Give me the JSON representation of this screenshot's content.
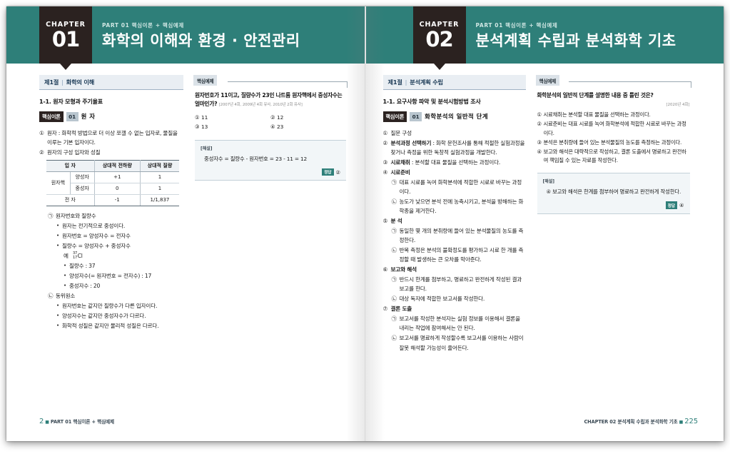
{
  "left_page": {
    "chapter": {
      "word": "CHAPTER",
      "number": "01",
      "kicker": "PART 01 핵심이론 + 핵심예제",
      "title": "화학의 이해와 환경 · 안전관리"
    },
    "section_bar": {
      "no": "제1절",
      "sep": "|",
      "title": "화학의 이해"
    },
    "topic": "1-1. 원자 모형과 주기율표",
    "core": {
      "tag": "핵심이론",
      "num": "01",
      "title": "원 자"
    },
    "items": {
      "i1_mark": "①",
      "i1_text": "원자 : 화학적 방법으로 더 이상 쪼갤 수 없는 입자로, 물질을 이루는 기본 입자이다.",
      "i2_mark": "②",
      "i2_text": "원자의 구성 입자와 성질",
      "i3_mark": "㉠",
      "i3_text": "원자번호와 질량수",
      "b1": "원자는 전기적으로 중성이다.",
      "b2": "원자번호 = 양성자수 = 전자수",
      "b3": "질량수 = 양성자수 + 중성자수",
      "ex_mark": "예",
      "ex_sup": "37",
      "ex_sub": "17",
      "ex_sym": "Cl",
      "b4": "질량수 : 37",
      "b5": "양성자수(= 원자번호 = 전자수) : 17",
      "b6": "중성자수 : 20",
      "i4_mark": "㉡",
      "i4_text": "동위원소",
      "b7": "원자번호는 같지만 질량수가 다른 입자이다.",
      "b8": "양성자수는 같지만 중성자수가 다르다.",
      "b9": "화학적 성질은 같지만 물리적 성질은 다르다.",
      "dot": "•"
    },
    "table": {
      "headers": [
        "입 자",
        "상대적 전하량",
        "상대적 질량"
      ],
      "rows": [
        {
          "group": "원자핵",
          "name": "양성자",
          "charge": "+1",
          "mass": "1"
        },
        {
          "group": "",
          "name": "중성자",
          "charge": "0",
          "mass": "1"
        },
        {
          "group": "전 자",
          "name": "",
          "charge": "-1",
          "mass": "1/1,837"
        }
      ]
    },
    "example": {
      "tag": "핵심예제",
      "question": "원자번호가 11이고, 질량수가 23인 나트륨 원자핵에서 중성자수는 얼마인가?",
      "source": "[2007년 4회, 2009년 4회 유사, 2010년 2회 유사]",
      "choices": [
        "① 11",
        "② 12",
        "③ 13",
        "④ 23"
      ],
      "solution_label": "[해설]",
      "solution_text": "중성자수 = 질량수 - 원자번호 = 23 - 11 = 12",
      "answer_tag": "정답",
      "answer_value": "②"
    },
    "footer": {
      "page": "2",
      "square": "■",
      "text": "PART 01 핵심이론 + 핵심예제"
    }
  },
  "right_page": {
    "chapter": {
      "word": "CHAPTER",
      "number": "02",
      "kicker": "PART 01 핵심이론 + 핵심예제",
      "title": "분석계획 수립과 분석화학 기초"
    },
    "section_bar": {
      "no": "제1절",
      "sep": "|",
      "title": "분석계획 수립"
    },
    "topic": "1-1. 요구사항 파악 및 분석시험방법 조사",
    "core": {
      "tag": "핵심이론",
      "num": "01",
      "title": "화학분석의 일반적 단계"
    },
    "steps": {
      "s1_mark": "①",
      "s1_text": "질문 구성",
      "s2_mark": "②",
      "s2_label": "분석과정 선택하기",
      "s2_text": " : 화학 문헌조사를 통해 적절한 실험과정을 찾거나 측정을 위한 독창적 실험과정을 개발한다.",
      "s3_mark": "③",
      "s3_label": "시료채취",
      "s3_text": " : 분석할 대표 물질을 선택하는 과정이다.",
      "s4_mark": "④",
      "s4_label": "시료준비",
      "s4a_mark": "㉠",
      "s4a_text": "대표 시료를 녹여 화학분석에 적합한 시료로 바꾸는 과정이다.",
      "s4b_mark": "㉡",
      "s4b_text": "농도가 낮으면 분석 전에 농축시키고, 분석을 방해하는 화학종을 제거한다.",
      "s5_mark": "⑤",
      "s5_label": "분 석",
      "s5a_mark": "㉠",
      "s5a_text": "동일한 몇 개의 분취량에 들어 있는 분석물질의 농도를 측정한다.",
      "s5b_mark": "㉡",
      "s5b_text": "반복 측정은 분석의 불확정도를 평가하고 시료 한 개를 측정할 때 발생하는 큰 오차를 막아준다.",
      "s6_mark": "⑥",
      "s6_label": "보고와 해석",
      "s6a_mark": "㉠",
      "s6a_text": "반드시 한계를 첨부하고, 명료하고 완전하게 작성된 결과보고를 한다.",
      "s6b_mark": "㉡",
      "s6b_text": "대상 독자에 적합한 보고서를 작성한다.",
      "s7_mark": "⑦",
      "s7_label": "결론 도출",
      "s7a_mark": "㉠",
      "s7a_text": "보고서를 작성한 분석자는 실험 정보를 이용해서 결론을 내리는 작업에 참여해서는 안 된다.",
      "s7b_mark": "㉡",
      "s7b_text": "보고서를 명료하게 작성할수록 보고서를 이용하는 사람이 잘못 해석할 가능성이 줄어든다."
    },
    "example": {
      "tag": "핵심예제",
      "question": "화학분석의 일반적 단계를 설명한 내용 중 틀린 것은?",
      "source": "[2020년 4회]",
      "choices": [
        {
          "mark": "①",
          "text": "시료채취는 분석할 대표 물질을 선택하는 과정이다."
        },
        {
          "mark": "②",
          "text": "시료준비는 대표 시료를 녹여 화학분석에 적합한 시료로 바꾸는 과정이다."
        },
        {
          "mark": "③",
          "text": "분석은 분취량에 들어 있는 분석물질의 농도를 측정하는 과정이다."
        },
        {
          "mark": "④",
          "text": "보고와 해석은 대략적으로 작성하고, 결론 도출에서 명료하고 완전하여 책임질 수 있는 자료를 작성한다."
        }
      ],
      "solution_label": "[해설]",
      "solution_text": "④ 보고와 해석은 한계를 첨부하여 명료하고 완전하게 작성한다.",
      "answer_tag": "정답",
      "answer_value": "④"
    },
    "footer": {
      "text": "CHAPTER 02 분석계획 수립과 분석화학 기초",
      "square": "■",
      "page": "225"
    }
  },
  "colors": {
    "teal": "#2e7f79",
    "dark": "#2b2220",
    "section_bar": "#e9eef3",
    "solution_bg": "#f2f6f8"
  }
}
